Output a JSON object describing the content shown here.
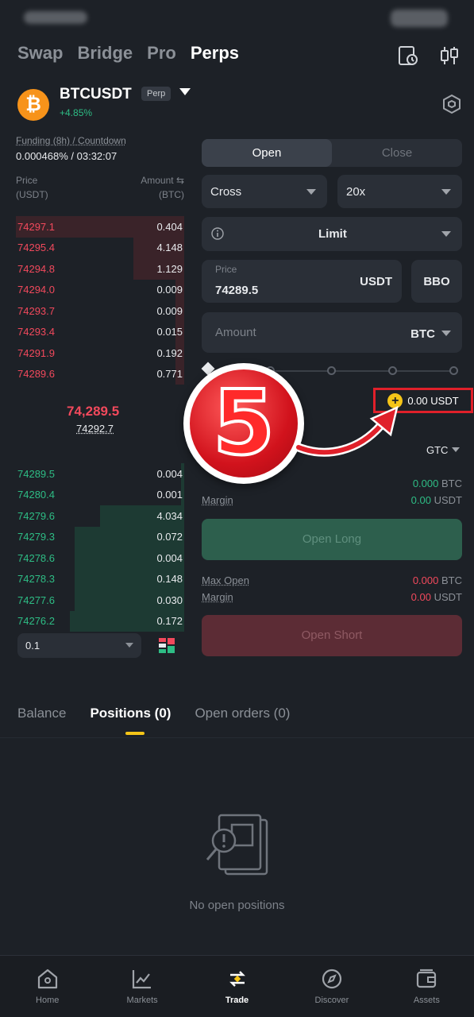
{
  "top_nav": {
    "items": [
      "Swap",
      "Bridge",
      "Pro",
      "Perps"
    ],
    "active": "Perps"
  },
  "pair": {
    "symbol": "BTCUSDT",
    "badge": "Perp",
    "change": "+4.85%",
    "coin_glyph": "₿"
  },
  "funding": {
    "label": "Funding (8h) / Countdown",
    "value": "0.000468% / 03:32:07"
  },
  "orderbook": {
    "price_header": "Price",
    "price_unit": "(USDT)",
    "amount_header": "Amount ⇆",
    "amount_unit": "(BTC)",
    "asks": [
      {
        "price": "74297.1",
        "amount": "0.404",
        "depth": 1.0
      },
      {
        "price": "74295.4",
        "amount": "4.148",
        "depth": 0.3
      },
      {
        "price": "74294.8",
        "amount": "1.129",
        "depth": 0.3
      },
      {
        "price": "74294.0",
        "amount": "0.009",
        "depth": 0.05
      },
      {
        "price": "74293.7",
        "amount": "0.009",
        "depth": 0.05
      },
      {
        "price": "74293.4",
        "amount": "0.015",
        "depth": 0.05
      },
      {
        "price": "74291.9",
        "amount": "0.192",
        "depth": 0.05
      },
      {
        "price": "74289.6",
        "amount": "0.771",
        "depth": 0.05
      }
    ],
    "mid_price": "74,289.5",
    "mark_price": "74292.7",
    "bids": [
      {
        "price": "74289.5",
        "amount": "0.004",
        "depth": 0.02
      },
      {
        "price": "74280.4",
        "amount": "0.001",
        "depth": 0.02
      },
      {
        "price": "74279.6",
        "amount": "4.034",
        "depth": 0.5
      },
      {
        "price": "74279.3",
        "amount": "0.072",
        "depth": 0.65
      },
      {
        "price": "74278.6",
        "amount": "0.004",
        "depth": 0.65
      },
      {
        "price": "74278.3",
        "amount": "0.148",
        "depth": 0.65
      },
      {
        "price": "74277.6",
        "amount": "0.030",
        "depth": 0.65
      },
      {
        "price": "74276.2",
        "amount": "0.172",
        "depth": 0.68
      }
    ],
    "precision": "0.1"
  },
  "form": {
    "open_label": "Open",
    "close_label": "Close",
    "margin_mode": "Cross",
    "leverage": "20x",
    "order_type": "Limit",
    "price_label": "Price",
    "price_value": "74289.5",
    "price_unit": "USDT",
    "bbo": "BBO",
    "amount_placeholder": "Amount",
    "amount_unit": "BTC",
    "available": "0.00 USDT",
    "tif": "GTC",
    "long_max_value": "0.000",
    "long_max_unit": "BTC",
    "long_margin_label": "Margin",
    "long_margin_value": "0.00",
    "long_margin_unit": "USDT",
    "open_long": "Open Long",
    "short_max_label": "Max Open",
    "short_max_value": "0.000",
    "short_max_unit": "BTC",
    "short_margin_label": "Margin",
    "short_margin_value": "0.00",
    "short_margin_unit": "USDT",
    "open_short": "Open Short"
  },
  "annotation": {
    "step_number": "5",
    "highlight_color": "#e0202a"
  },
  "tabs": {
    "balance": "Balance",
    "positions": "Positions (0)",
    "open_orders": "Open orders (0)"
  },
  "empty_state": "No open positions",
  "bottom_nav": [
    {
      "label": "Home",
      "icon": "home-icon"
    },
    {
      "label": "Markets",
      "icon": "markets-icon"
    },
    {
      "label": "Trade",
      "icon": "trade-icon"
    },
    {
      "label": "Discover",
      "icon": "discover-icon"
    },
    {
      "label": "Assets",
      "icon": "assets-icon"
    }
  ],
  "colors": {
    "ask": "#f2495c",
    "bid": "#2ebd85",
    "accent": "#f5c518",
    "background": "#1d2127"
  }
}
